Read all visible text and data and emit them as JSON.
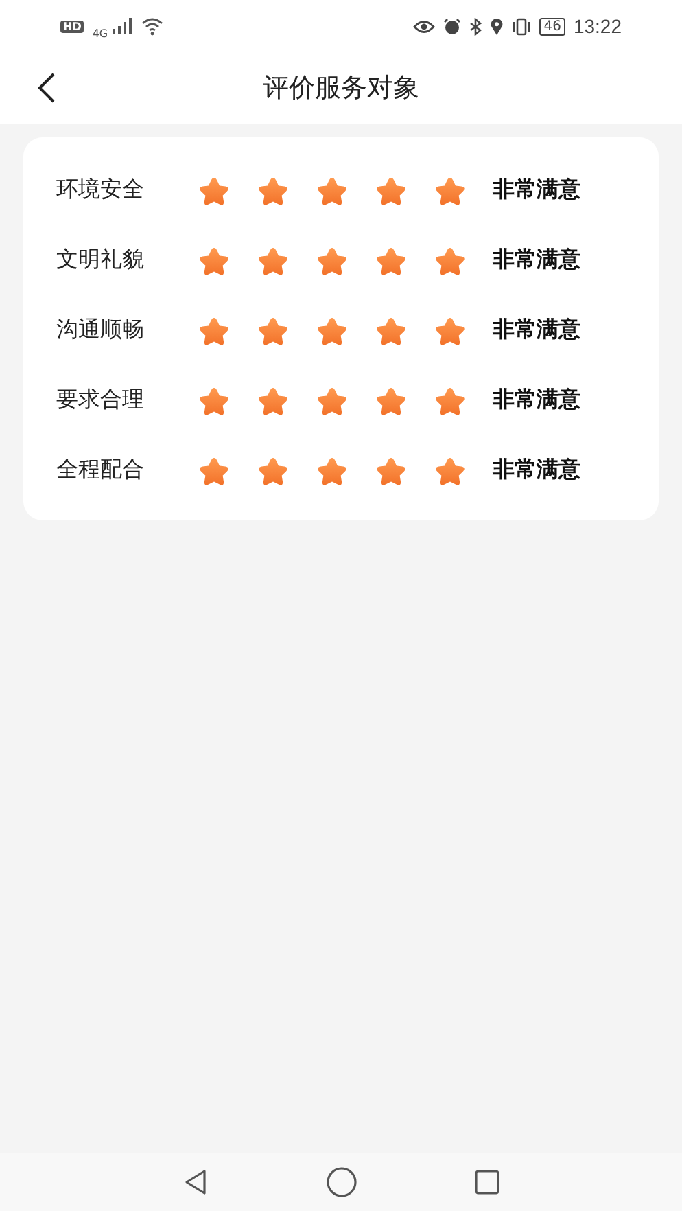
{
  "status_bar": {
    "hd": "HD",
    "network": "4G",
    "battery": "46",
    "time": "13:22"
  },
  "header": {
    "title": "评价服务对象"
  },
  "ratings": [
    {
      "label": "环境安全",
      "stars": 5,
      "verdict": "非常满意"
    },
    {
      "label": "文明礼貌",
      "stars": 5,
      "verdict": "非常满意"
    },
    {
      "label": "沟通顺畅",
      "stars": 5,
      "verdict": "非常满意"
    },
    {
      "label": "要求合理",
      "stars": 5,
      "verdict": "非常满意"
    },
    {
      "label": "全程配合",
      "stars": 5,
      "verdict": "非常满意"
    }
  ]
}
